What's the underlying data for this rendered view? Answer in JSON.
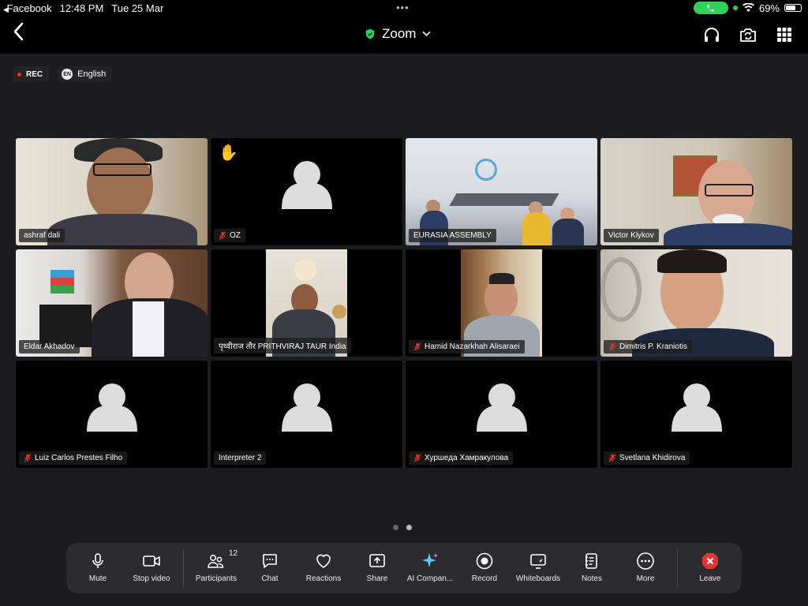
{
  "status_bar": {
    "back_app": "Facebook",
    "time": "12:48 PM",
    "date": "Tue 25 Mar",
    "battery": "69%",
    "battery_level": 0.69
  },
  "nav": {
    "title": "Zoom",
    "icons": [
      "back-chevron-icon",
      "shield-check-icon",
      "headphones-icon",
      "camera-switch-icon",
      "grid-icon"
    ]
  },
  "badges": {
    "rec": "REC",
    "lang_code": "EN",
    "language": "English"
  },
  "participants": [
    {
      "name": "ashraf dali",
      "muted": false,
      "video": true
    },
    {
      "name": "OZ",
      "muted": true,
      "video": false,
      "hand_raised": true
    },
    {
      "name": "EURASIA ASSEMBLY",
      "muted": false,
      "video": true,
      "active_speaker": true
    },
    {
      "name": "Victor Klykov",
      "muted": false,
      "video": true
    },
    {
      "name": "Eldar Akhadov",
      "muted": false,
      "video": true
    },
    {
      "name": "पृथ्वीराज तौर  PRITHVIRAJ TAUR India",
      "muted": false,
      "video": true
    },
    {
      "name": "Hamid Nazarkhah Alisaraei",
      "muted": true,
      "video": true
    },
    {
      "name": "Dimitris P. Kraniotis",
      "muted": true,
      "video": true
    },
    {
      "name": "Luiz Carlos Prestes Filho",
      "muted": true,
      "video": false
    },
    {
      "name": "Interpreter 2",
      "muted": false,
      "video": false
    },
    {
      "name": "Хуршеда Хамракулова",
      "muted": true,
      "video": false
    },
    {
      "name": "Svetlana Khidirova",
      "muted": true,
      "video": false
    }
  ],
  "pages": {
    "total": 2,
    "current": 2
  },
  "toolbar": {
    "mute": "Mute",
    "stop_video": "Stop video",
    "participants": "Participants",
    "participants_count": "12",
    "chat": "Chat",
    "reactions": "Reactions",
    "share": "Share",
    "ai_companion": "AI Compan...",
    "record": "Record",
    "whiteboards": "Whiteboards",
    "notes": "Notes",
    "more": "More",
    "leave": "Leave"
  },
  "colors": {
    "accent_green": "#30d158",
    "speaker_outline": "#3cc85b",
    "leave_red": "#e5342f",
    "background": "#1c1c1e"
  }
}
